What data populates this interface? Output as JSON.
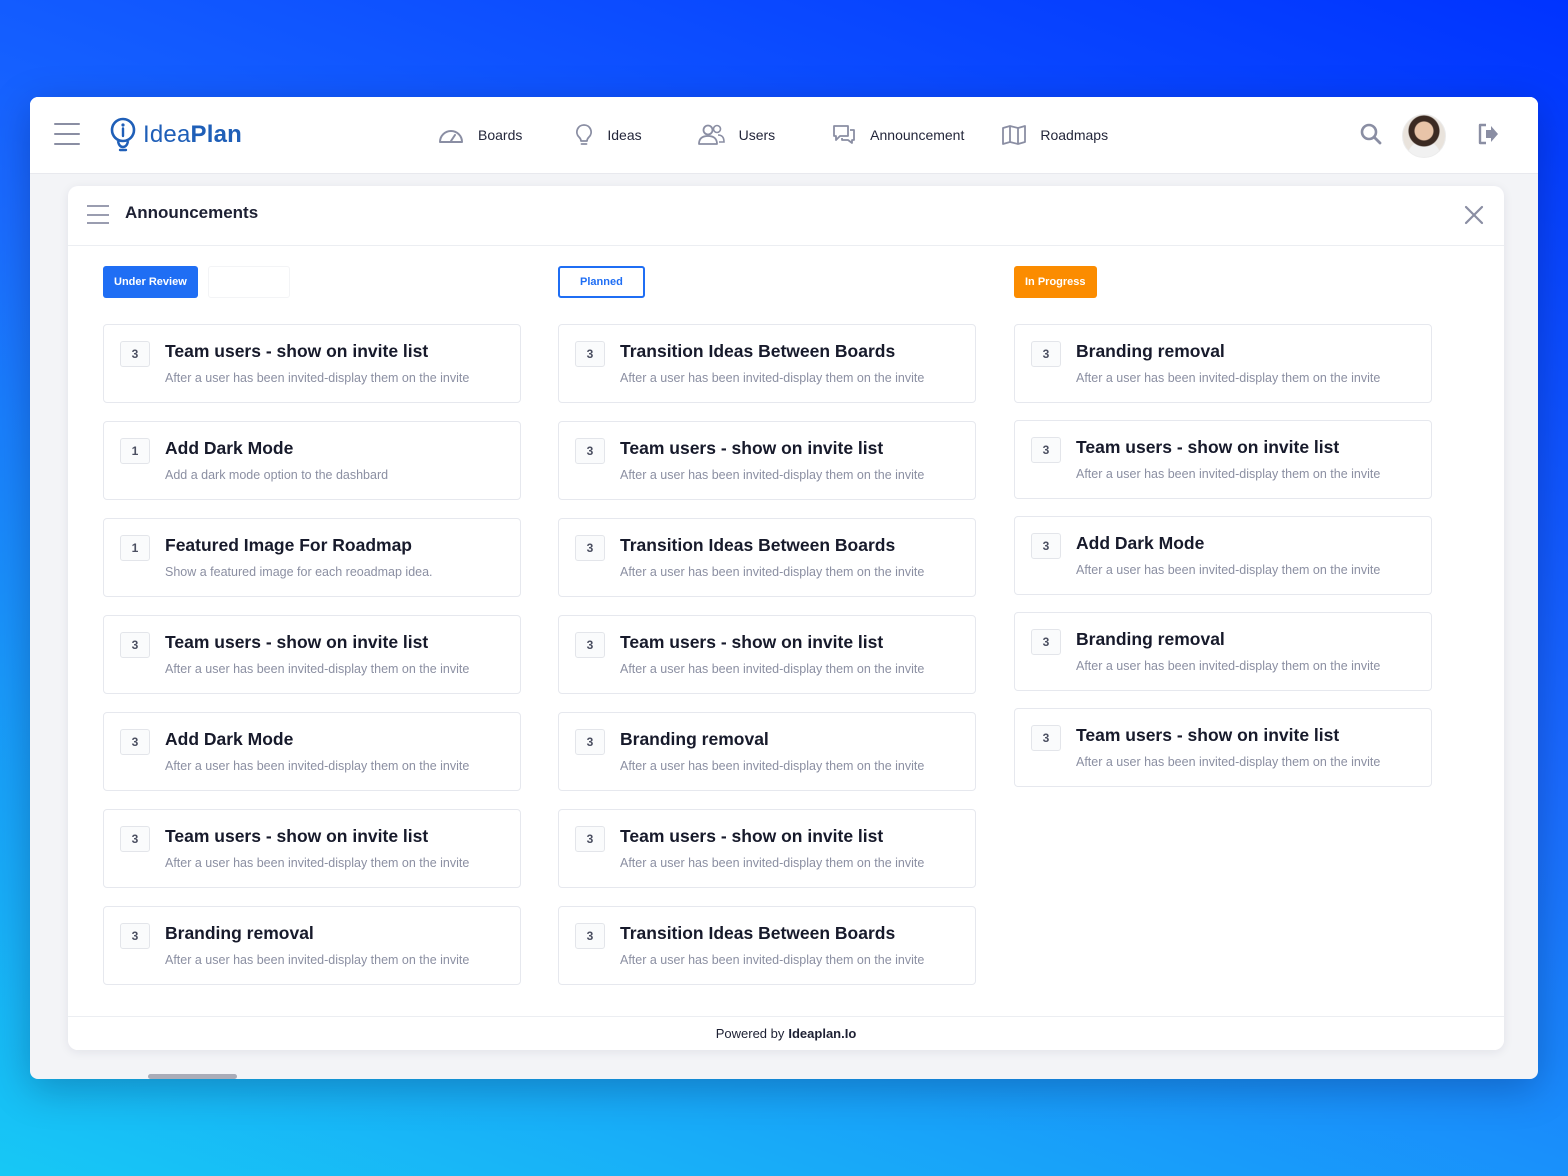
{
  "app": {
    "logo_text_light": "Idea",
    "logo_text_bold": "Plan"
  },
  "nav": {
    "items": [
      {
        "label": "Boards",
        "icon": "gauge-icon"
      },
      {
        "label": "Ideas",
        "icon": "lightbulb-icon"
      },
      {
        "label": "Users",
        "icon": "users-icon"
      },
      {
        "label": "Announcement",
        "icon": "chat-bubbles-icon"
      },
      {
        "label": "Roadmaps",
        "icon": "map-icon"
      }
    ]
  },
  "colors": {
    "brand": "#1f5fb8",
    "accent": "#1f6ef4",
    "in_progress": "#fb8c00"
  },
  "panel": {
    "title": "Announcements"
  },
  "columns": [
    {
      "status": "Under Review",
      "cards": [
        {
          "votes": "3",
          "title": "Team users - show on invite list",
          "desc": "After a user has been invited-display them on the invite"
        },
        {
          "votes": "1",
          "title": "Add Dark Mode",
          "desc": "Add a dark mode option to the dashbard"
        },
        {
          "votes": "1",
          "title": "Featured Image For Roadmap",
          "desc": "Show a featured image for each reoadmap idea."
        },
        {
          "votes": "3",
          "title": "Team users - show on invite list",
          "desc": "After a user has been invited-display them on the invite"
        },
        {
          "votes": "3",
          "title": "Add Dark Mode",
          "desc": "After a user has been invited-display them on the invite"
        },
        {
          "votes": "3",
          "title": "Team users - show on invite list",
          "desc": "After a user has been invited-display them on the invite"
        },
        {
          "votes": "3",
          "title": "Branding removal",
          "desc": "After a user has been invited-display them on the invite"
        }
      ]
    },
    {
      "status": "Planned",
      "cards": [
        {
          "votes": "3",
          "title": "Transition Ideas Between Boards",
          "desc": "After a user has been invited-display them on the invite"
        },
        {
          "votes": "3",
          "title": "Team users - show on invite list",
          "desc": "After a user has been invited-display them on the invite"
        },
        {
          "votes": "3",
          "title": "Transition Ideas Between Boards",
          "desc": "After a user has been invited-display them on the invite"
        },
        {
          "votes": "3",
          "title": "Team users - show on invite list",
          "desc": "After a user has been invited-display them on the invite"
        },
        {
          "votes": "3",
          "title": "Branding removal",
          "desc": "After a user has been invited-display them on the invite"
        },
        {
          "votes": "3",
          "title": "Team users - show on invite list",
          "desc": "After a user has been invited-display them on the invite"
        },
        {
          "votes": "3",
          "title": "Transition Ideas Between Boards",
          "desc": "After a user has been invited-display them on the invite"
        }
      ]
    },
    {
      "status": "In Progress",
      "cards": [
        {
          "votes": "3",
          "title": "Branding removal",
          "desc": "After a user has been invited-display them on the invite"
        },
        {
          "votes": "3",
          "title": "Team users - show on invite list",
          "desc": "After a user has been invited-display them on the invite"
        },
        {
          "votes": "3",
          "title": "Add Dark Mode",
          "desc": "After a user has been invited-display them on the invite"
        },
        {
          "votes": "3",
          "title": "Branding removal",
          "desc": "After a user has been invited-display them on the invite"
        },
        {
          "votes": "3",
          "title": "Team users - show on invite list",
          "desc": "After a user has been invited-display them on the invite"
        }
      ]
    }
  ],
  "footer": {
    "prefix": "Powered by",
    "brand": "Ideaplan.Io"
  }
}
